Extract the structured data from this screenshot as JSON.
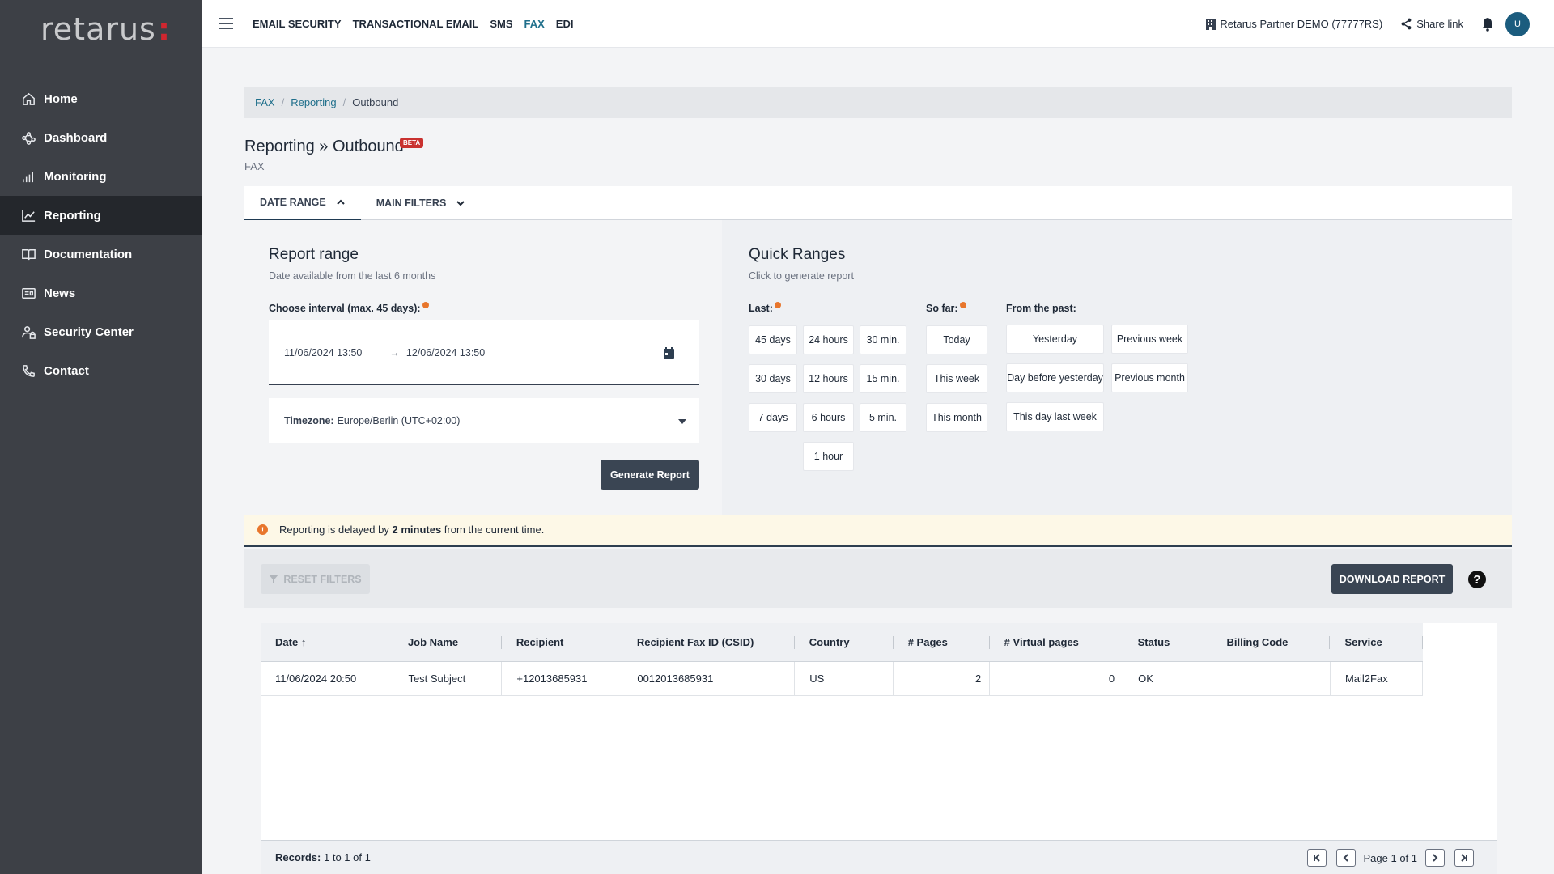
{
  "app": {
    "logo": "retarus",
    "logo_dot": ":"
  },
  "sidebar": {
    "items": [
      {
        "label": "Home",
        "icon": "home-icon"
      },
      {
        "label": "Dashboard",
        "icon": "dashboard-icon"
      },
      {
        "label": "Monitoring",
        "icon": "monitoring-icon"
      },
      {
        "label": "Reporting",
        "icon": "reporting-icon",
        "active": true
      },
      {
        "label": "Documentation",
        "icon": "book-icon"
      },
      {
        "label": "News",
        "icon": "news-icon"
      },
      {
        "label": "Security Center",
        "icon": "security-icon"
      },
      {
        "label": "Contact",
        "icon": "phone-icon"
      }
    ]
  },
  "topbar": {
    "nav": [
      "EMAIL SECURITY",
      "TRANSACTIONAL EMAIL",
      "SMS",
      "FAX",
      "EDI"
    ],
    "active_nav": "FAX",
    "org": "Retarus Partner DEMO (77777RS)",
    "share": "Share link",
    "avatar": "U"
  },
  "breadcrumb": [
    "FAX",
    "Reporting",
    "Outbound"
  ],
  "page": {
    "title": "Reporting » Outbound",
    "badge": "BETA",
    "subtitle": "FAX"
  },
  "tabs": [
    "DATE RANGE",
    "MAIN FILTERS"
  ],
  "report_range": {
    "title": "Report range",
    "subtitle": "Date available from the last 6 months",
    "interval_label": "Choose interval (max. 45 days):",
    "from": "11/06/2024 13:50",
    "to": "12/06/2024 13:50",
    "timezone_label": "Timezone:",
    "timezone_value": "Europe/Berlin (UTC+02:00)",
    "generate": "Generate Report"
  },
  "quick_ranges": {
    "title": "Quick Ranges",
    "subtitle": "Click to generate report",
    "last_label": "Last:",
    "sofar_label": "So far:",
    "past_label": "From the past:",
    "last": [
      "45 days",
      "24 hours",
      "30 min.",
      "30 days",
      "12 hours",
      "15 min.",
      "7 days",
      "6 hours",
      "5 min.",
      "1 hour"
    ],
    "sofar": [
      "Today",
      "This week",
      "This month"
    ],
    "past": [
      "Yesterday",
      "Previous week",
      "Day before yesterday",
      "Previous month",
      "This day last week"
    ]
  },
  "notice": {
    "prefix": "Reporting is delayed by ",
    "bold": "2 minutes",
    "suffix": " from the current time."
  },
  "actions": {
    "reset": "RESET FILTERS",
    "download": "DOWNLOAD REPORT",
    "help": "?"
  },
  "table": {
    "columns": [
      "Date",
      "Job Name",
      "Recipient",
      "Recipient Fax ID (CSID)",
      "Country",
      "# Pages",
      "# Virtual pages",
      "Status",
      "Billing Code",
      "Service"
    ],
    "rows": [
      [
        "11/06/2024 20:50",
        "Test Subject",
        "+12013685931",
        "0012013685931",
        "US",
        "2",
        "0",
        "OK",
        "",
        "Mail2Fax"
      ]
    ],
    "records_label": "Records:",
    "records_value": "1 to 1 of 1",
    "page_label": "Page 1 of 1"
  },
  "colors": {
    "sidebar": "#3d4046",
    "accent": "#1f6f8b",
    "primary_button": "#3a4553",
    "warning": "#e8762c",
    "beta": "#c9312f"
  }
}
